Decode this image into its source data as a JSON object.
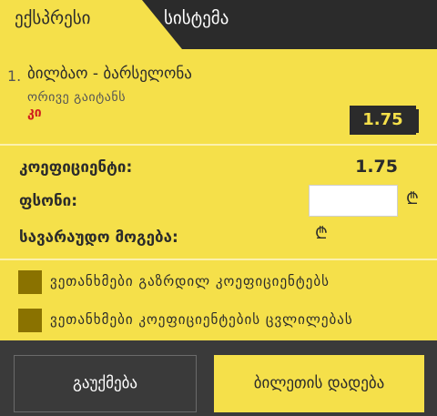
{
  "tabs": {
    "express_label": "ექსპრესი",
    "system_label": "სისტემა"
  },
  "bet": {
    "number": "1.",
    "title": "ბილბაო - ბარსელონა",
    "market": "ორივე გაიტანს",
    "outcome": "კი",
    "odds": "1.75"
  },
  "summary": {
    "coef_label": "კოეფიციენტი:",
    "coef_value": "1.75",
    "stake_label": "ფსონი:",
    "stake_value": "",
    "win_label": "სავარაუდო მოგება:",
    "currency": "₾"
  },
  "options": [
    {
      "label": "ვეთანხმები გაზრდილ კოეფიციენტებს",
      "checked": false
    },
    {
      "label": "ვეთანხმები კოეფიციენტების ცვლილებას",
      "checked": false
    }
  ],
  "footer": {
    "cancel_label": "გაუქმება",
    "place_label": "ბილეთის დადება"
  },
  "colors": {
    "accent_yellow": "#f5e04a",
    "dark": "#2b2b2b",
    "outcome_red": "#d0201f",
    "checkbox": "#8a7200"
  }
}
